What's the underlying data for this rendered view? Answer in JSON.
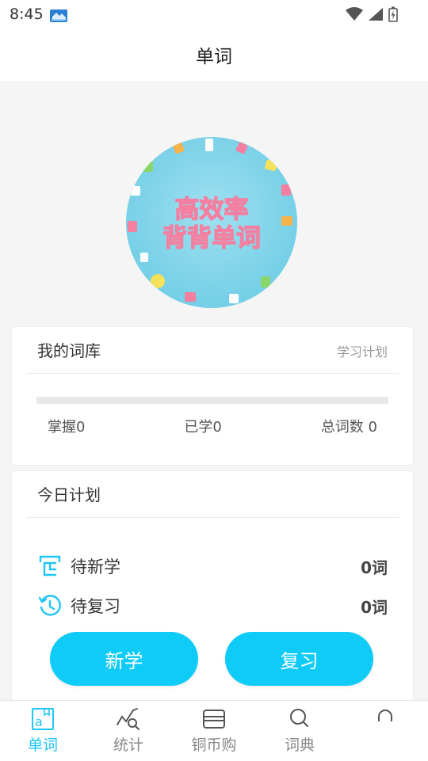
{
  "status_bar": {
    "time": "8:45",
    "icons": [
      "app-notification-icon",
      "wifi-icon",
      "signal-icon",
      "battery-icon"
    ]
  },
  "header": {
    "title": "单词"
  },
  "banner": {
    "line1": "高效率",
    "line2": "背背单词"
  },
  "library": {
    "title": "我的词库",
    "plan_link": "学习计划",
    "progress": 0,
    "mastered": "掌握0",
    "learned": "已学0",
    "total": "总词数 0"
  },
  "today_plan": {
    "title": "今日计划",
    "rows": [
      {
        "label": "待新学",
        "count": "0词",
        "icon": "new-learn-icon"
      },
      {
        "label": "待复习",
        "count": "0词",
        "icon": "history-icon"
      }
    ],
    "new_button": "新学",
    "review_button": "复习"
  },
  "tabs": [
    {
      "label": "单词",
      "icon": "word-tab-icon",
      "active": true
    },
    {
      "label": "统计",
      "icon": "stats-tab-icon",
      "active": false
    },
    {
      "label": "铜币购",
      "icon": "wallet-tab-icon",
      "active": false
    },
    {
      "label": "词典",
      "icon": "search-tab-icon",
      "active": false
    },
    {
      "label": "",
      "icon": "profile-tab-icon",
      "active": false
    }
  ],
  "colors": {
    "accent": "#0fcbf7",
    "active_tab": "#1ec6f5"
  }
}
